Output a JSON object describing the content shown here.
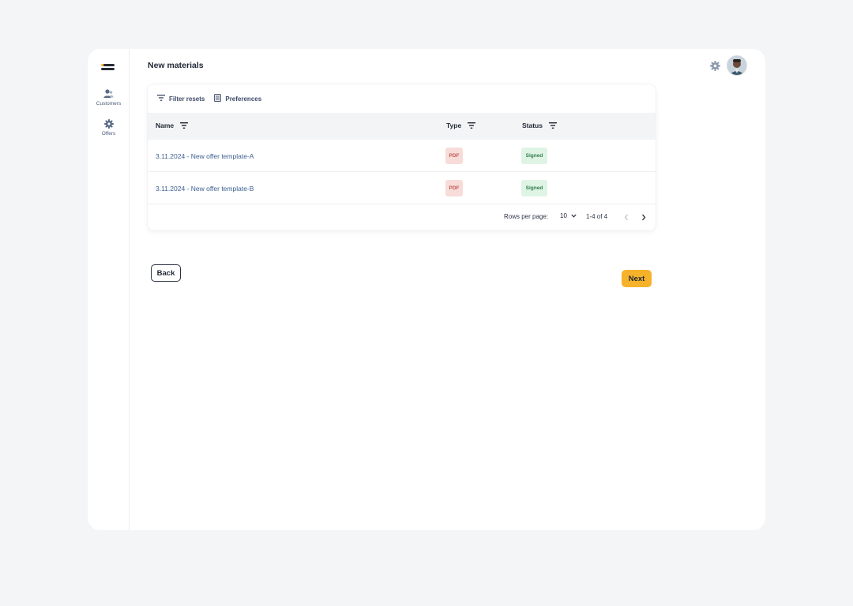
{
  "page": {
    "title": "New materials"
  },
  "sidebar": {
    "items": [
      {
        "label": "Customers",
        "icon": "users-icon"
      },
      {
        "label": "Offers",
        "icon": "gear-icon"
      }
    ]
  },
  "header": {
    "settings_icon": "gear-icon",
    "avatar": "user-avatar"
  },
  "toolbar": {
    "filter_label": "Filter resets",
    "preferences_label": "Preferences"
  },
  "table": {
    "columns": [
      "Name",
      "Type",
      "Status"
    ],
    "rows": [
      {
        "name": "3.11.2024 - New offer template-A",
        "type": "PDF",
        "status": "Signed"
      },
      {
        "name": "3.11.2024 - New offer template-B",
        "type": "PDF",
        "status": "Signed"
      }
    ]
  },
  "pagination": {
    "rows_per_page_label": "Rows per page:",
    "rows_per_page_value": "10",
    "range": "1-4 of 4"
  },
  "actions": {
    "back_label": "Back",
    "next_label": "Next"
  },
  "colors": {
    "accent": "#f5b22a",
    "link": "#3b5f8f",
    "pdf_bg": "#f7dcda",
    "signed_bg": "#dff4e5"
  }
}
